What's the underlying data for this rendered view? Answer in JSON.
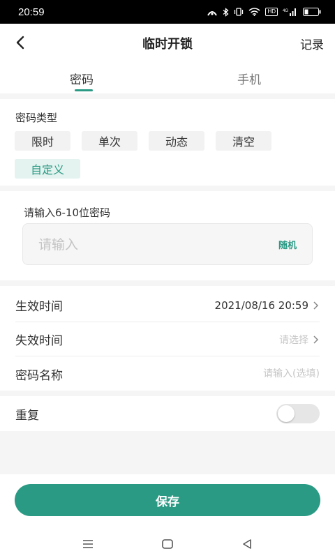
{
  "status_bar": {
    "time": "20:59",
    "hd": "HD",
    "net": "4G"
  },
  "header": {
    "title": "临时开锁",
    "record": "记录"
  },
  "tabs": [
    {
      "label": "密码"
    },
    {
      "label": "手机"
    }
  ],
  "password_type": {
    "label": "密码类型",
    "options": [
      {
        "label": "限时"
      },
      {
        "label": "单次"
      },
      {
        "label": "动态"
      },
      {
        "label": "清空"
      },
      {
        "label": "自定义"
      }
    ],
    "selected": "自定义"
  },
  "password_input": {
    "label": "请输入6-10位密码",
    "placeholder": "请输入",
    "random": "随机"
  },
  "settings": {
    "effective_time": {
      "label": "生效时间",
      "value": "2021/08/16 20:59"
    },
    "expire_time": {
      "label": "失效时间",
      "placeholder": "请选择"
    },
    "password_name": {
      "label": "密码名称",
      "placeholder": "请输入(选填)"
    },
    "repeat": {
      "label": "重复",
      "enabled": false
    }
  },
  "save_button": {
    "label": "保存"
  },
  "colors": {
    "accent": "#2a9a84",
    "accent_light": "#e4f3ef"
  }
}
